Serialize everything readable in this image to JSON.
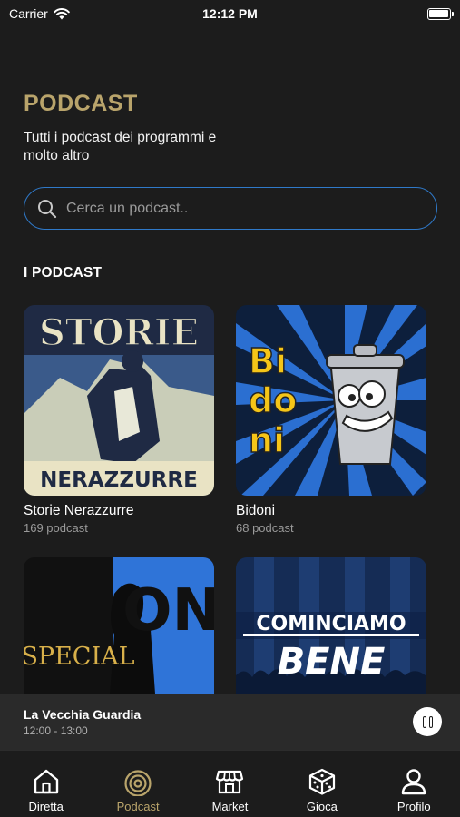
{
  "status_bar": {
    "carrier": "Carrier",
    "time": "12:12 PM"
  },
  "header": {
    "title": "PODCAST",
    "subtitle": "Tutti i podcast dei programmi e molto altro"
  },
  "search": {
    "placeholder": "Cerca un podcast.."
  },
  "section": {
    "label": "I PODCAST"
  },
  "podcasts": [
    {
      "title": "Storie Nerazzurre",
      "count": "169 podcast",
      "cover_text_top": "STORIE",
      "cover_text_bottom": "NERAZZURRE"
    },
    {
      "title": "Bidoni",
      "count": "68 podcast",
      "cover_text": [
        "Bi",
        "do",
        "ni"
      ]
    },
    {
      "title": "",
      "count": "",
      "cover_text_left": "SPECIAL",
      "cover_text_right": "ONE"
    },
    {
      "title": "",
      "count": "",
      "cover_text_top": "COMINCIAMO",
      "cover_text_bottom": "BENE"
    }
  ],
  "now_playing": {
    "title": "La Vecchia Guardia",
    "time": "12:00 - 13:00"
  },
  "tabs": [
    {
      "label": "Diretta",
      "icon": "home-icon",
      "active": false
    },
    {
      "label": "Podcast",
      "icon": "podcast-icon",
      "active": true
    },
    {
      "label": "Market",
      "icon": "store-icon",
      "active": false
    },
    {
      "label": "Gioca",
      "icon": "dice-icon",
      "active": false
    },
    {
      "label": "Profilo",
      "icon": "user-icon",
      "active": false
    }
  ],
  "colors": {
    "accent": "#b9a46b",
    "background": "#1c1c1c",
    "search_border": "#2f79c9",
    "inter_blue": "#1f5fa8"
  }
}
